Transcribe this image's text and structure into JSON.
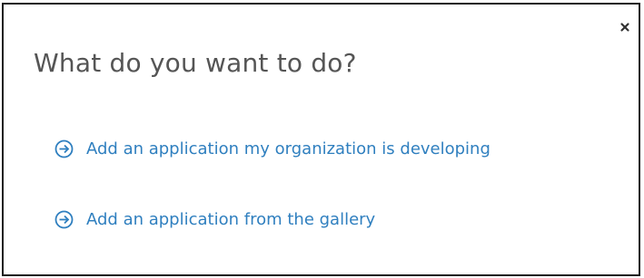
{
  "dialog": {
    "title": "What do you want to do?",
    "close_icon": "close-icon",
    "accent_color": "#2f7fbf",
    "options": [
      {
        "icon": "arrow-circle-right-icon",
        "label": "Add an application my organization is developing"
      },
      {
        "icon": "arrow-circle-right-icon",
        "label": "Add an application from the gallery"
      }
    ]
  }
}
